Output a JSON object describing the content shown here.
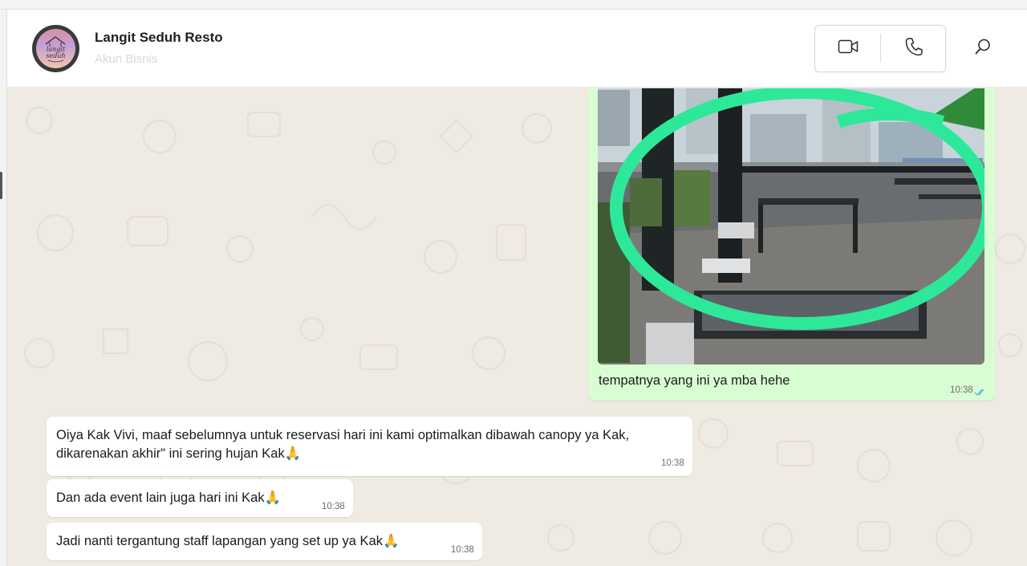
{
  "contact": {
    "name": "Langit Seduh Resto",
    "subtitle": "Akun Bisnis",
    "avatar_text_line1": "langit",
    "avatar_text_line2": "seduh"
  },
  "header_icons": [
    "video-call-icon",
    "voice-call-icon",
    "search-icon"
  ],
  "colors": {
    "outgoing_bubble": "#d9fdd3",
    "incoming_bubble": "#ffffff",
    "chat_background": "#efeae2",
    "read_ticks": "#53bdeb",
    "photo_marker": "#2ee89a"
  },
  "messages": [
    {
      "direction": "outgoing",
      "type": "image",
      "caption": "tempatnya yang ini ya mba hehe",
      "time": "10:38",
      "status": "read"
    },
    {
      "direction": "incoming",
      "line1": "Oiya Kak Vivi, maaf sebelumnya untuk reservasi hari ini kami optimalkan dibawah canopy ya Kak,",
      "line2": "dikarenakan akhir\" ini sering hujan Kak🙏",
      "time": "10:38"
    },
    {
      "direction": "incoming",
      "text": "Dan ada event lain juga hari ini Kak🙏",
      "time": "10:38"
    },
    {
      "direction": "incoming",
      "text": "Jadi nanti tergantung staff lapangan yang set up ya Kak🙏",
      "time": "10:38"
    }
  ]
}
